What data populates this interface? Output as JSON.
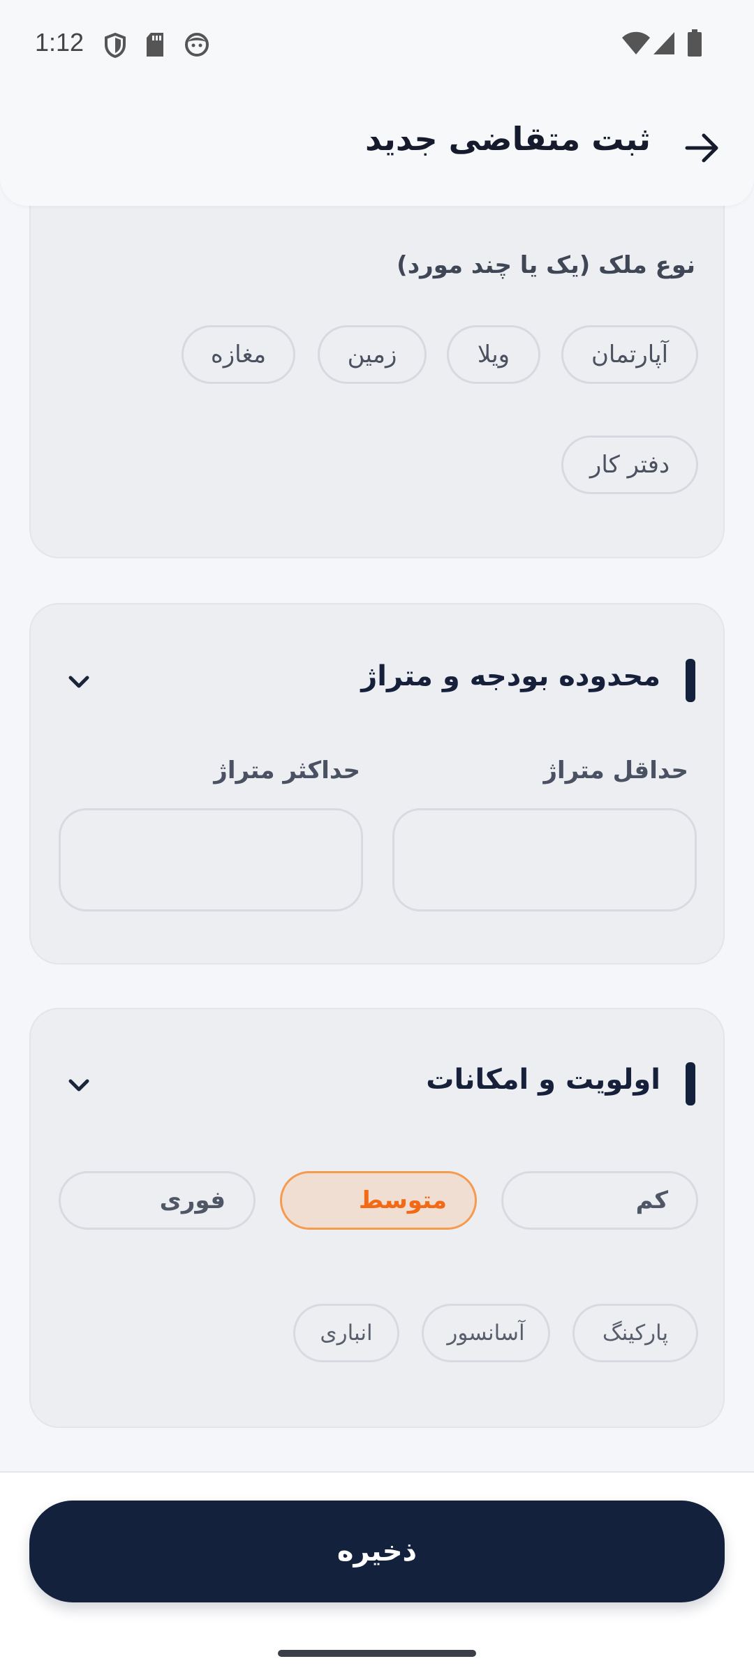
{
  "status_bar": {
    "time": "1:12",
    "icons": [
      "shield-icon",
      "sd-card-icon",
      "face-icon",
      "wifi-icon",
      "signal-icon",
      "battery-icon"
    ]
  },
  "header": {
    "title": "ثبت متقاضی جدید",
    "back_icon": "arrow-right-icon"
  },
  "property_type": {
    "label": "نوع ملک (یک یا چند مورد)",
    "options": [
      "آپارتمان",
      "ویلا",
      "زمین",
      "مغازه",
      "دفتر کار"
    ]
  },
  "budget_section": {
    "title": "محدوده بودجه و متراژ",
    "min_area_label": "حداقل متراژ",
    "max_area_label": "حداکثر متراژ",
    "min_area_value": "",
    "max_area_value": ""
  },
  "priority_section": {
    "title": "اولویت و امکانات",
    "priorities": [
      "کم",
      "متوسط",
      "فوری"
    ],
    "selected_priority": "متوسط",
    "features": [
      "پارکینگ",
      "آسانسور",
      "انباری"
    ]
  },
  "footer": {
    "save_label": "ذخیره"
  },
  "colors": {
    "primary": "#14213d",
    "accent": "#f26a16",
    "accent_bg": "#f0ded3",
    "background": "#f4f6f9"
  }
}
